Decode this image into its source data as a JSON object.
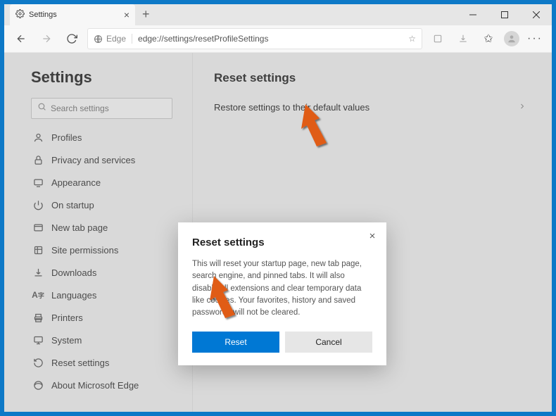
{
  "tab": {
    "title": "Settings"
  },
  "address": {
    "prefix": "Edge",
    "url": "edge://settings/resetProfileSettings"
  },
  "sidebar": {
    "title": "Settings",
    "search_placeholder": "Search settings",
    "items": [
      {
        "label": "Profiles"
      },
      {
        "label": "Privacy and services"
      },
      {
        "label": "Appearance"
      },
      {
        "label": "On startup"
      },
      {
        "label": "New tab page"
      },
      {
        "label": "Site permissions"
      },
      {
        "label": "Downloads"
      },
      {
        "label": "Languages"
      },
      {
        "label": "Printers"
      },
      {
        "label": "System"
      },
      {
        "label": "Reset settings"
      },
      {
        "label": "About Microsoft Edge"
      }
    ]
  },
  "main": {
    "title": "Reset settings",
    "restore_label": "Restore settings to their default values"
  },
  "dialog": {
    "title": "Reset settings",
    "text": "This will reset your startup page, new tab page, search engine, and pinned tabs. It will also disable all extensions and clear temporary data like cookies. Your favorites, history and saved passwords will not be cleared.",
    "reset_label": "Reset",
    "cancel_label": "Cancel"
  }
}
